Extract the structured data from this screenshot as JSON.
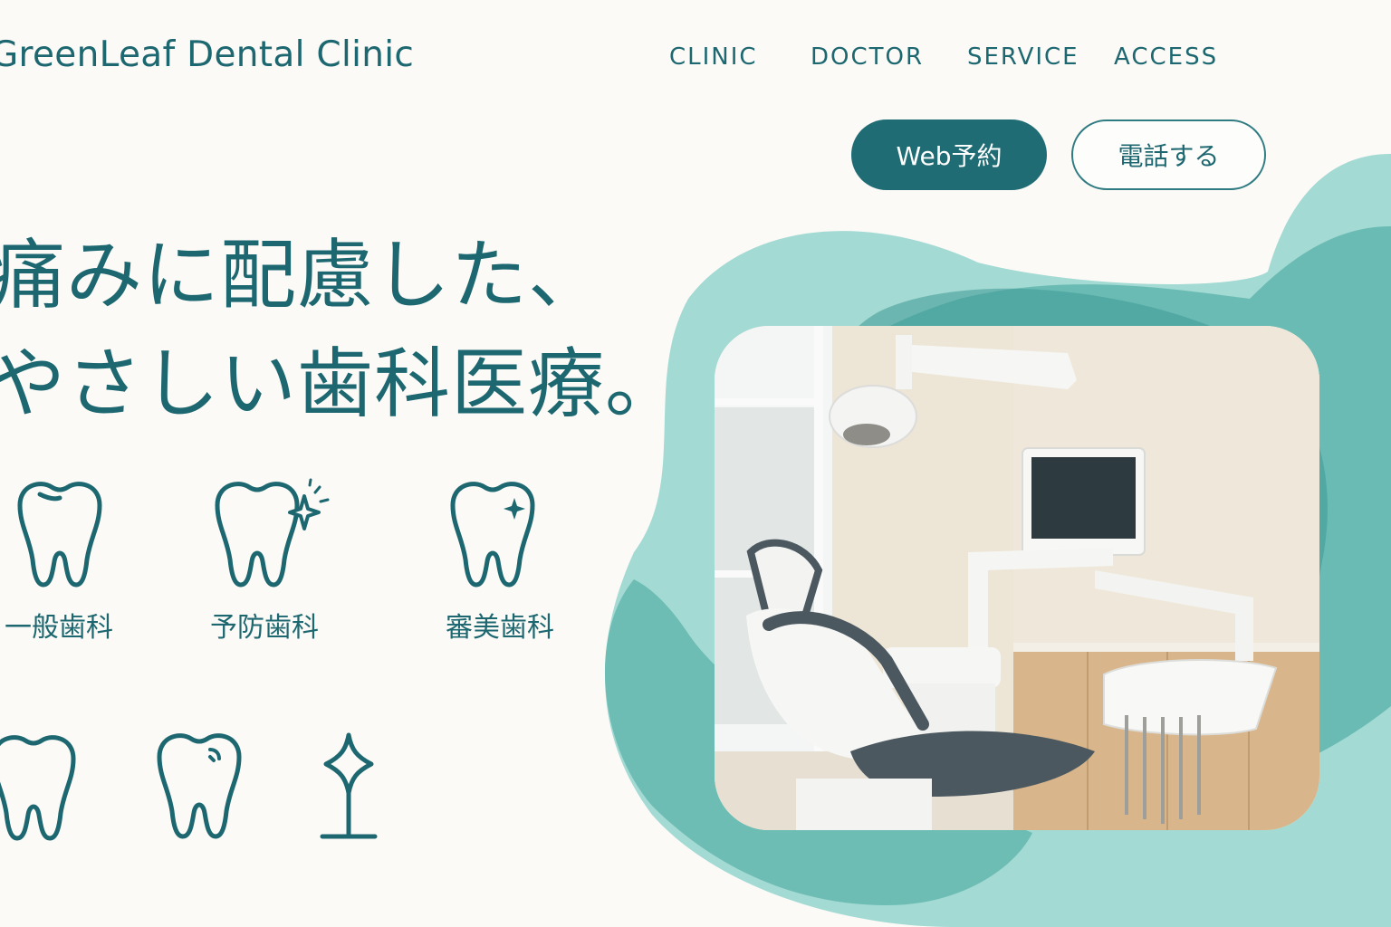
{
  "header": {
    "logo": "GreenLeaf Dental Clinic",
    "nav": [
      "CLINIC",
      "DOCTOR",
      "SERVICE",
      "ACCESS"
    ]
  },
  "cta": {
    "reserve_label": "Web予約",
    "call_label": "電話する"
  },
  "hero": {
    "title_line1": "痛みに配慮した、",
    "title_line2": "やさしい歯科医療。"
  },
  "services": [
    {
      "label": "一般歯科",
      "icon": "tooth-icon"
    },
    {
      "label": "予防歯科",
      "icon": "tooth-sparkle-icon"
    },
    {
      "label": "審美歯科",
      "icon": "tooth-shine-icon"
    }
  ],
  "extra_icons": [
    "tooth-icon",
    "tooth-dented-icon",
    "implant-icon"
  ],
  "colors": {
    "primary": "#1d6770",
    "button": "#1f6c74",
    "blob_light": "#9fd8d1",
    "blob_mid": "#5bb3ac",
    "blob_dark": "#2f8f8f",
    "background": "#fbfaf6"
  }
}
